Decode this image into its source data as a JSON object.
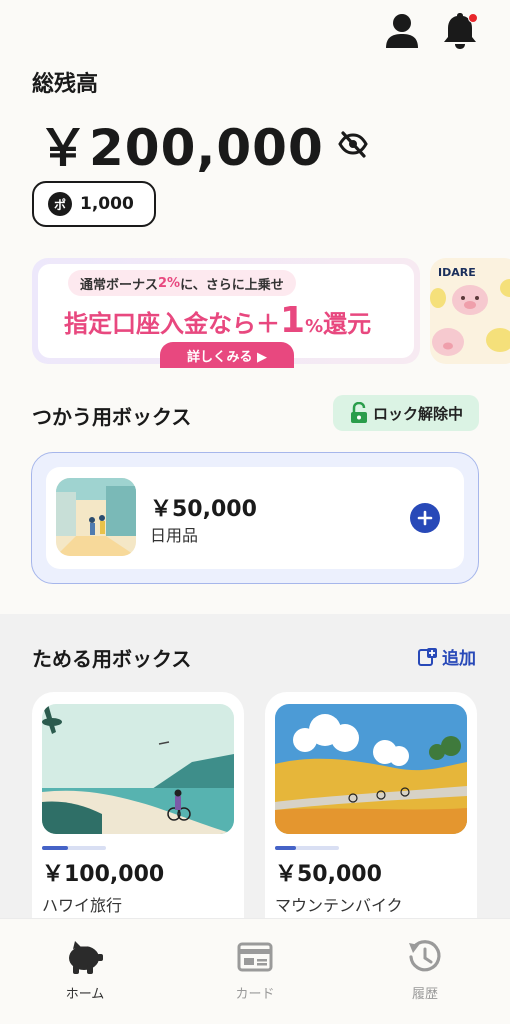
{
  "header": {
    "profile_icon": "person-icon",
    "notification_icon": "bell-icon",
    "notification_dot_color": "#e8262b"
  },
  "balance": {
    "label": "総残高",
    "amount": "￥200,000",
    "toggle_icon": "eye-off-icon"
  },
  "points": {
    "badge": "ポ",
    "value": "1,000"
  },
  "banner": {
    "top_text_before": "通常ボーナス",
    "top_text_pct": "2%",
    "top_text_after": "に、さらに上乗せ",
    "main_before": "指定口座入金なら＋",
    "main_big": "1",
    "main_pct": "%",
    "main_after": "還元",
    "button_label": "詳しくみる ▶",
    "next_banner_brand": "IDARE"
  },
  "spend_section": {
    "title": "つかう用ボックス",
    "lock_label": "ロック解除中",
    "box": {
      "amount": "￥50,000",
      "name": "日用品"
    }
  },
  "save_section": {
    "title": "ためる用ボックス",
    "add_label": "追加",
    "boxes": [
      {
        "amount": "￥100,000",
        "name": "ハワイ旅行",
        "progress": 0.4
      },
      {
        "amount": "￥50,000",
        "name": "マウンテンバイク",
        "progress": 0.33
      }
    ]
  },
  "nav": {
    "items": [
      {
        "label": "ホーム",
        "icon": "piggy-bank-icon",
        "active": true
      },
      {
        "label": "カード",
        "icon": "card-icon",
        "active": false
      },
      {
        "label": "履歴",
        "icon": "history-icon",
        "active": false
      }
    ]
  },
  "colors": {
    "accent_blue": "#2849b8",
    "accent_pink": "#e8487f",
    "lock_green": "#2a9d4b"
  }
}
